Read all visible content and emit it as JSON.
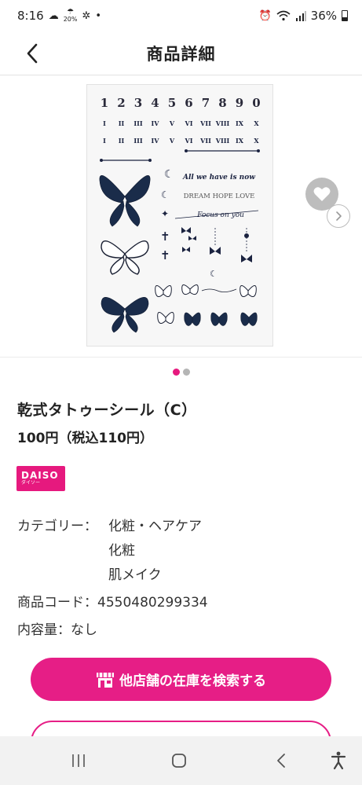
{
  "status_bar": {
    "time": "8:16",
    "weather_temp": "20%",
    "battery": "36%",
    "icons": [
      "cloud-icon",
      "weather-icon",
      "fan-icon",
      "dot-icon",
      "alarm-icon",
      "wifi-icon",
      "signal-icon",
      "battery-icon"
    ]
  },
  "header": {
    "title": "商品詳細",
    "back_icon": "chevron-left-icon"
  },
  "carousel": {
    "image_alt": "乾式タトゥーシール（C）",
    "favorite_icon": "heart-icon",
    "next_icon": "chevron-right-icon",
    "page_count": 2,
    "active_index": 0,
    "sheet": {
      "numbers": [
        "1",
        "2",
        "3",
        "4",
        "5",
        "6",
        "7",
        "8",
        "9",
        "0"
      ],
      "roman_row1": [
        "I",
        "II",
        "III",
        "IV",
        "V",
        "VI",
        "VII",
        "VIII",
        "IX",
        "X"
      ],
      "roman_row2": [
        "I",
        "II",
        "III",
        "IV",
        "V",
        "VI",
        "VII",
        "VIII",
        "IX",
        "X"
      ],
      "phrase1": "All we have is now",
      "phrase2": "DREAM HOPE LOVE",
      "phrase3": "Focus on you"
    }
  },
  "product": {
    "name": "乾式タトゥーシール（C）",
    "price": "100円（税込110円）",
    "brand": {
      "name": "DAISO",
      "kana": "ダイソー",
      "color": "#e6197e"
    },
    "category_label": "カテゴリー：",
    "categories": [
      "化粧・ヘアケア",
      "化粧",
      "肌メイク"
    ],
    "code": "商品コード：4550480299334",
    "content": "内容量：なし"
  },
  "actions": {
    "search_stock_label": "他店舗の在庫を検索する",
    "search_stock_icon": "store-icon",
    "accent_color": "#e61e86"
  },
  "nav_bar": {
    "icons": [
      "recent-apps-icon",
      "home-icon",
      "back-icon",
      "accessibility-icon"
    ]
  }
}
